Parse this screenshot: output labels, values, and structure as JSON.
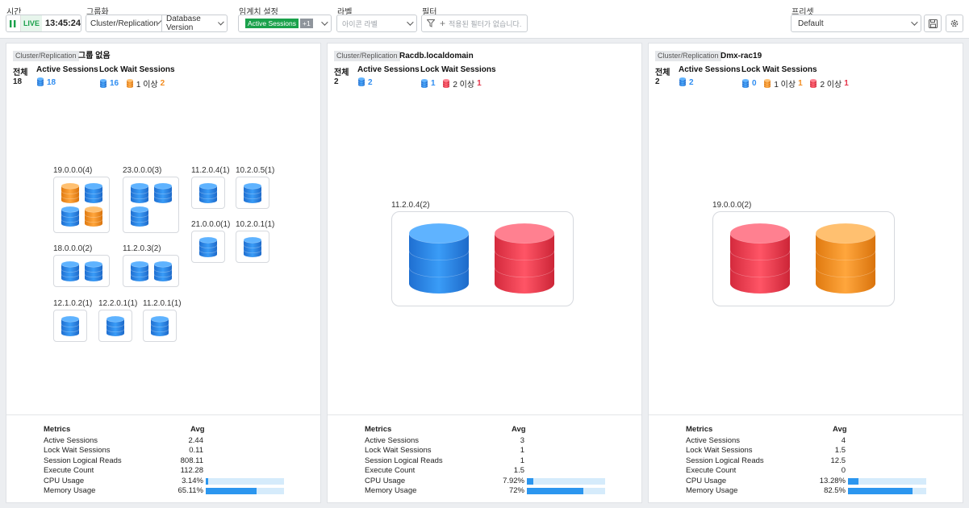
{
  "toolbar": {
    "time_label": "시간",
    "live": "LIVE",
    "clock": "13:45:24",
    "group_label": "그룹화",
    "group_primary": "Cluster/Replication",
    "group_secondary": "Database Version",
    "threshold_label": "임계치 설정",
    "threshold_chip": "Active Sessions",
    "threshold_more": "+1",
    "tag_label": "라벨",
    "tag_placeholder": "아이콘 라벨",
    "filter_label": "필터",
    "filter_placeholder": "적용된 필터가 없습니다.",
    "preset_label": "프리셋",
    "preset_value": "Default"
  },
  "colors": {
    "blue": "#2f8df1",
    "orange": "#f28c20",
    "red": "#e5344a",
    "bar": "#2b96ef",
    "live": "#1aa14b"
  },
  "summary_headers": {
    "total": "전체",
    "active": "Active Sessions",
    "lock": "Lock Wait Sessions"
  },
  "metrics_headers": {
    "name": "Metrics",
    "avg": "Avg"
  },
  "panels": [
    {
      "tag": "Cluster/Replication",
      "title": "그룹 없음",
      "total": "18",
      "active": "18",
      "lock_blue": "16",
      "lock_level1_text": "1 이상",
      "lock_level1_count": "2",
      "groups": [
        {
          "label": "19.0.0.0(4)",
          "dbs": [
            "orange",
            "blue",
            "blue",
            "orange"
          ]
        },
        {
          "label": "23.0.0.0(3)",
          "dbs": [
            "blue",
            "blue",
            "blue"
          ]
        },
        {
          "label": "11.2.0.4(1)",
          "dbs": [
            "blue"
          ]
        },
        {
          "label": "10.2.0.5(1)",
          "dbs": [
            "blue"
          ]
        },
        {
          "label": "21.0.0.0(1)",
          "dbs": [
            "blue"
          ]
        },
        {
          "label": "10.2.0.1(1)",
          "dbs": [
            "blue"
          ]
        },
        {
          "label": "18.0.0.0(2)",
          "dbs": [
            "blue",
            "blue"
          ]
        },
        {
          "label": "11.2.0.3(2)",
          "dbs": [
            "blue",
            "blue"
          ]
        },
        {
          "label": "12.1.0.2(1)",
          "dbs": [
            "blue"
          ]
        },
        {
          "label": "12.2.0.1(1)",
          "dbs": [
            "blue"
          ]
        },
        {
          "label": "11.2.0.1(1)",
          "dbs": [
            "blue"
          ]
        }
      ],
      "metrics": [
        {
          "name": "Active Sessions",
          "avg": "2.44"
        },
        {
          "name": "Lock Wait Sessions",
          "avg": "0.11"
        },
        {
          "name": "Session Logical Reads",
          "avg": "808.11"
        },
        {
          "name": "Execute Count",
          "avg": "112.28"
        },
        {
          "name": "CPU Usage",
          "avg": "3.14%",
          "pct": 3.14
        },
        {
          "name": "Memory Usage",
          "avg": "65.11%",
          "pct": 65.11
        }
      ]
    },
    {
      "tag": "Cluster/Replication",
      "title": "Racdb.localdomain",
      "total": "2",
      "active": "2",
      "lock_blue": "1",
      "lock_level2_text": "2 이상",
      "lock_level2_count": "1",
      "groups": [
        {
          "label": "11.2.0.4(2)",
          "dbs": [
            "blue",
            "red"
          ]
        }
      ],
      "metrics": [
        {
          "name": "Active Sessions",
          "avg": "3"
        },
        {
          "name": "Lock Wait Sessions",
          "avg": "1"
        },
        {
          "name": "Session Logical Reads",
          "avg": "1"
        },
        {
          "name": "Execute Count",
          "avg": "1.5"
        },
        {
          "name": "CPU Usage",
          "avg": "7.92%",
          "pct": 7.92
        },
        {
          "name": "Memory Usage",
          "avg": "72%",
          "pct": 72
        }
      ]
    },
    {
      "tag": "Cluster/Replication",
      "title": "Dmx-rac19",
      "total": "2",
      "active": "2",
      "lock_blue": "0",
      "lock_level1_text": "1 이상",
      "lock_level1_count": "1",
      "lock_level2_text": "2 이상",
      "lock_level2_count": "1",
      "groups": [
        {
          "label": "19.0.0.0(2)",
          "dbs": [
            "red",
            "orange"
          ]
        }
      ],
      "metrics": [
        {
          "name": "Active Sessions",
          "avg": "4"
        },
        {
          "name": "Lock Wait Sessions",
          "avg": "1.5"
        },
        {
          "name": "Session Logical Reads",
          "avg": "12.5"
        },
        {
          "name": "Execute Count",
          "avg": "0"
        },
        {
          "name": "CPU Usage",
          "avg": "13.28%",
          "pct": 13.28
        },
        {
          "name": "Memory Usage",
          "avg": "82.5%",
          "pct": 82.5
        }
      ]
    }
  ]
}
